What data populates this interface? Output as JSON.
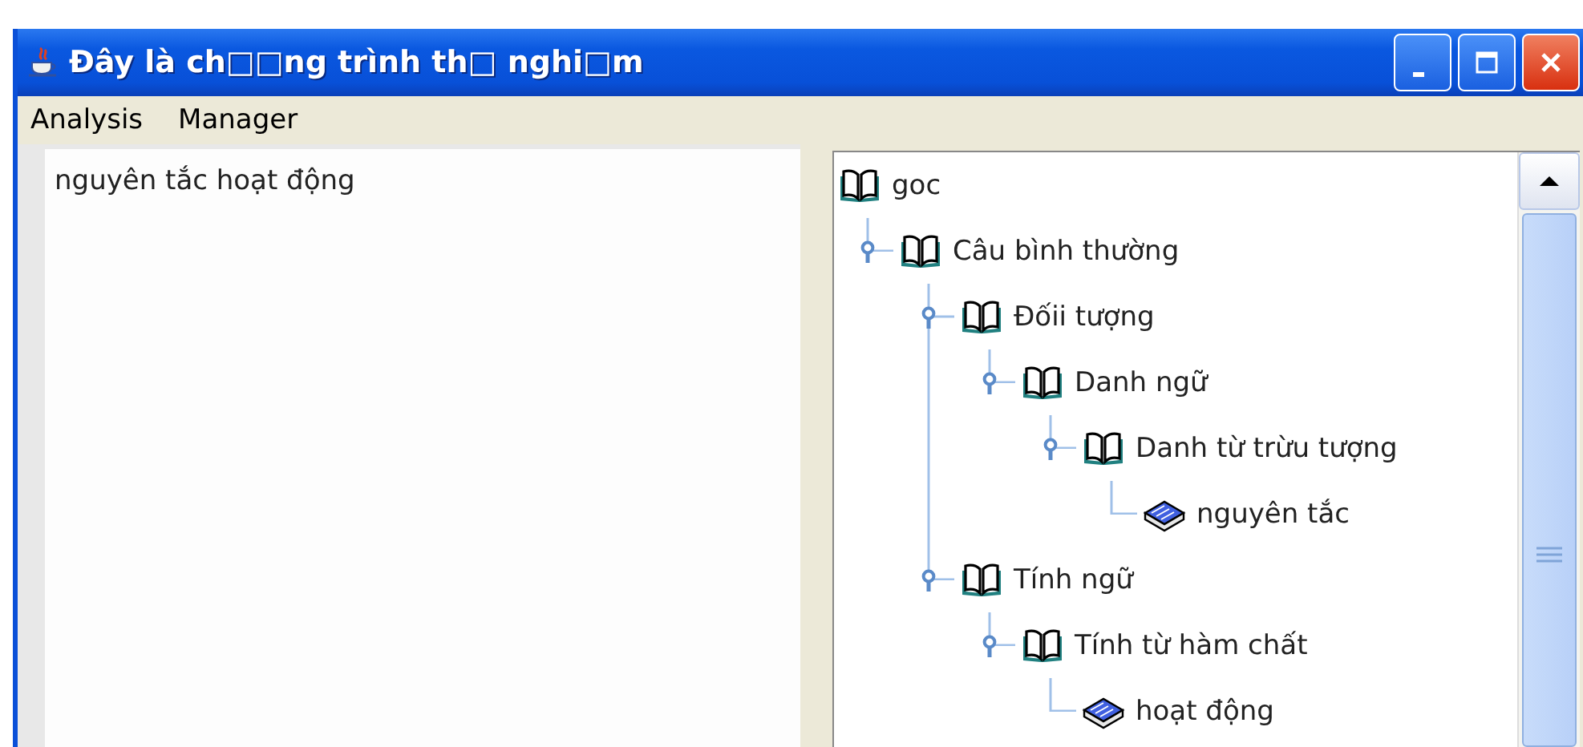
{
  "window": {
    "title": "Đây là ch□□ng trình th□ nghi□m"
  },
  "menu": [
    {
      "label": "Analysis"
    },
    {
      "label": "Manager"
    }
  ],
  "text_area": {
    "value": "nguyên tắc hoạt động"
  },
  "tree": {
    "root": {
      "label": "goc",
      "children": [
        {
          "label": "Câu bình thường",
          "expanded": true,
          "children": [
            {
              "label": "Đốii tượng",
              "expanded": true,
              "children": [
                {
                  "label": "Danh ngữ",
                  "expanded": true,
                  "children": [
                    {
                      "label": "Danh từ trừu tượng",
                      "expanded": true,
                      "children": [
                        {
                          "label": "nguyên tắc"
                        }
                      ]
                    }
                  ]
                }
              ]
            },
            {
              "label": "Tính ngữ",
              "expanded": true,
              "children": [
                {
                  "label": "Tính từ hàm chất",
                  "expanded": true,
                  "children": [
                    {
                      "label": "hoạt động"
                    }
                  ]
                }
              ]
            }
          ]
        }
      ]
    }
  }
}
